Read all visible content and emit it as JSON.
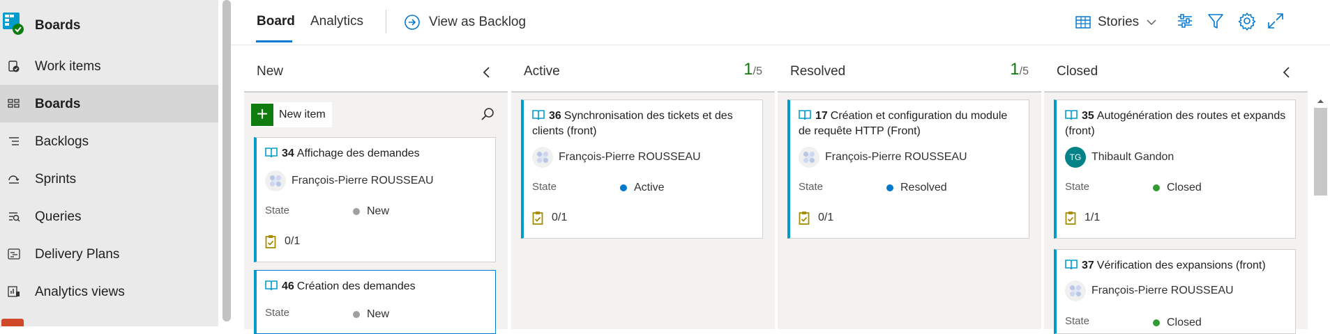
{
  "sidebar": {
    "title": "Boards",
    "items": [
      {
        "label": "Work items",
        "icon": "work-items-icon",
        "active": false
      },
      {
        "label": "Boards",
        "icon": "boards-icon",
        "active": true
      },
      {
        "label": "Backlogs",
        "icon": "backlogs-icon",
        "active": false
      },
      {
        "label": "Sprints",
        "icon": "sprints-icon",
        "active": false
      },
      {
        "label": "Queries",
        "icon": "queries-icon",
        "active": false
      },
      {
        "label": "Delivery Plans",
        "icon": "delivery-plans-icon",
        "active": false
      },
      {
        "label": "Analytics views",
        "icon": "analytics-views-icon",
        "active": false
      }
    ]
  },
  "topbar": {
    "tabs": [
      {
        "label": "Board",
        "selected": true
      },
      {
        "label": "Analytics",
        "selected": false
      }
    ],
    "view_as_backlog": "View as Backlog",
    "backlog_level": "Stories",
    "tools": [
      "column-options-icon",
      "filter-icon",
      "settings-icon",
      "fullscreen-icon"
    ]
  },
  "board": {
    "state_label": "State",
    "new_item_label": "New item",
    "columns": [
      {
        "name": "New",
        "collapsible": true,
        "cards": [
          {
            "id": "34",
            "title": "Affichage des demandes",
            "assignee": "François-Pierre ROUSSEAU",
            "state": "New",
            "tasks": "0/1"
          },
          {
            "id": "46",
            "title": "Création des demandes",
            "state": "New"
          }
        ]
      },
      {
        "name": "Active",
        "wip_current": "1",
        "wip_limit": "/5",
        "cards": [
          {
            "id": "36",
            "title": "Synchronisation des tickets et des clients (front)",
            "assignee": "François-Pierre ROUSSEAU",
            "state": "Active",
            "tasks": "0/1"
          }
        ]
      },
      {
        "name": "Resolved",
        "wip_current": "1",
        "wip_limit": "/5",
        "cards": [
          {
            "id": "17",
            "title": "Création et configuration du module de requête HTTP (Front)",
            "assignee": "François-Pierre ROUSSEAU",
            "state": "Resolved",
            "tasks": "0/1"
          }
        ]
      },
      {
        "name": "Closed",
        "collapsible": true,
        "cards": [
          {
            "id": "35",
            "title": "Autogénération des routes et expands (front)",
            "assignee": "Thibault Gandon",
            "assignee_initials": "TG",
            "state": "Closed",
            "tasks": "1/1"
          },
          {
            "id": "37",
            "title": "Vérification des expansions (front)",
            "assignee": "François-Pierre ROUSSEAU",
            "state": "Closed"
          }
        ]
      }
    ]
  },
  "colors": {
    "accent": "#0078d4",
    "card_stripe": "#009ccc",
    "state_new": "#a19f9d",
    "state_active": "#007acc",
    "state_resolved": "#007acc",
    "state_closed": "#339933",
    "wip_ok": "#107c10",
    "task_icon": "#a88b00"
  }
}
